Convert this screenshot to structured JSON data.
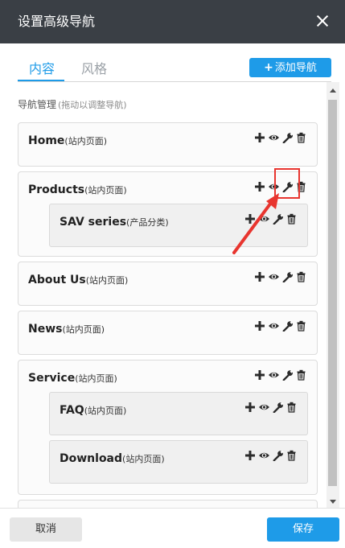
{
  "dialog": {
    "title": "设置高级导航"
  },
  "tabs": [
    {
      "label": "内容",
      "active": true
    },
    {
      "label": "风格",
      "active": false
    }
  ],
  "add_button": {
    "label": "添加导航"
  },
  "section": {
    "label": "导航管理",
    "hint": "(拖动以调整导航)"
  },
  "items": [
    {
      "name": "Home",
      "type": "(站内页面)"
    },
    {
      "name": "Products",
      "type": "(站内页面)",
      "children": [
        {
          "name": "SAV series",
          "type": "(产品分类)"
        }
      ]
    },
    {
      "name": "About Us",
      "type": "(站内页面)"
    },
    {
      "name": "News",
      "type": "(站内页面)"
    },
    {
      "name": "Service",
      "type": "(站内页面)",
      "children": [
        {
          "name": "FAQ",
          "type": "(站内页面)"
        },
        {
          "name": "Download",
          "type": "(站内页面)"
        }
      ]
    }
  ],
  "action_icons": [
    "plus-icon",
    "eye-icon",
    "wrench-icon",
    "trash-icon"
  ],
  "footer": {
    "cancel": "取消",
    "save": "保存"
  },
  "colors": {
    "accent": "#1e9be8",
    "titlebar": "#3a3f45",
    "annotation": "#e8352f"
  }
}
